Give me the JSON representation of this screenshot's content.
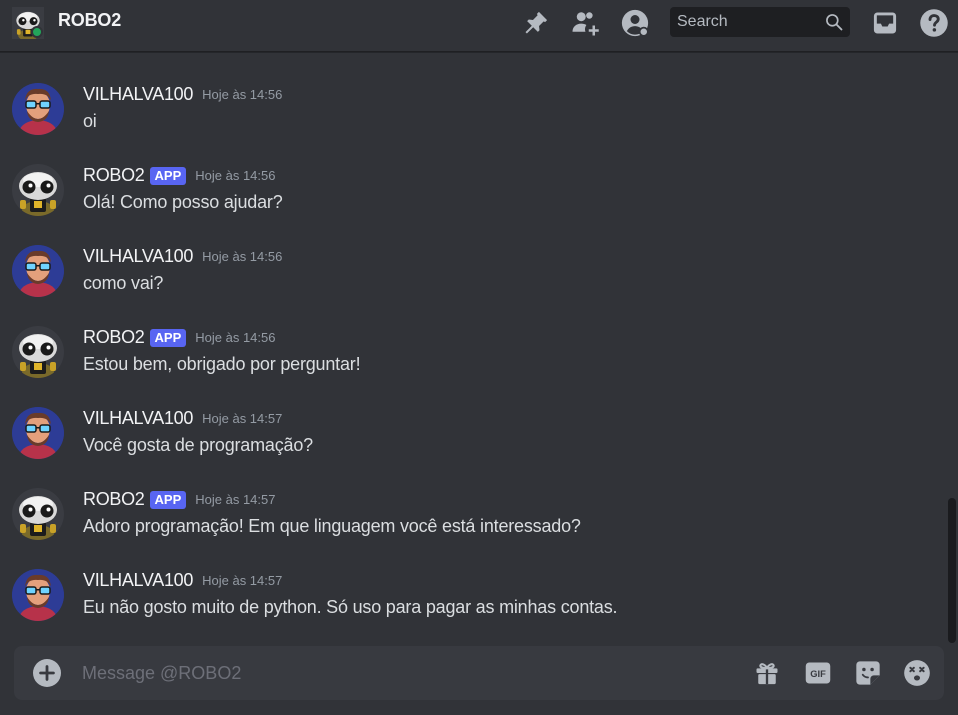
{
  "header": {
    "title": "ROBO2",
    "status": "online",
    "search_placeholder": "Search",
    "icons": [
      "pin-icon",
      "add-friend-icon",
      "user-profile-icon",
      "search-icon",
      "inbox-icon",
      "help-icon"
    ]
  },
  "colors": {
    "background": "#313338",
    "header": "#313338",
    "composer": "#383a40",
    "search": "#1e1f22",
    "badge": "#5865f2",
    "online": "#23a55a",
    "text": "#dbdee1",
    "muted": "#949ba4",
    "icon": "#b5bac1"
  },
  "messages": [
    {
      "author": "VILHALVA100",
      "badge": "",
      "time": "Hoje às 14:56",
      "text": "oi",
      "avatar": "user-avatar"
    },
    {
      "author": "ROBO2",
      "badge": "APP",
      "time": "Hoje às 14:56",
      "text": "Olá! Como posso ajudar?",
      "avatar": "robot-avatar"
    },
    {
      "author": "VILHALVA100",
      "badge": "",
      "time": "Hoje às 14:56",
      "text": "como vai?",
      "avatar": "user-avatar"
    },
    {
      "author": "ROBO2",
      "badge": "APP",
      "time": "Hoje às 14:56",
      "text": "Estou bem, obrigado por perguntar!",
      "avatar": "robot-avatar"
    },
    {
      "author": "VILHALVA100",
      "badge": "",
      "time": "Hoje às 14:57",
      "text": "Você gosta de programação?",
      "avatar": "user-avatar"
    },
    {
      "author": "ROBO2",
      "badge": "APP",
      "time": "Hoje às 14:57",
      "text": "Adoro programação! Em que linguagem você está interessado?",
      "avatar": "robot-avatar"
    },
    {
      "author": "VILHALVA100",
      "badge": "",
      "time": "Hoje às 14:57",
      "text": "Eu não gosto muito de python. Só uso para pagar as minhas contas.",
      "avatar": "user-avatar"
    }
  ],
  "composer": {
    "placeholder": "Message @ROBO2",
    "gif_label": "GIF",
    "icons": [
      "add-circle-icon",
      "gift-icon",
      "gif-icon",
      "sticker-icon",
      "emoji-icon"
    ]
  }
}
